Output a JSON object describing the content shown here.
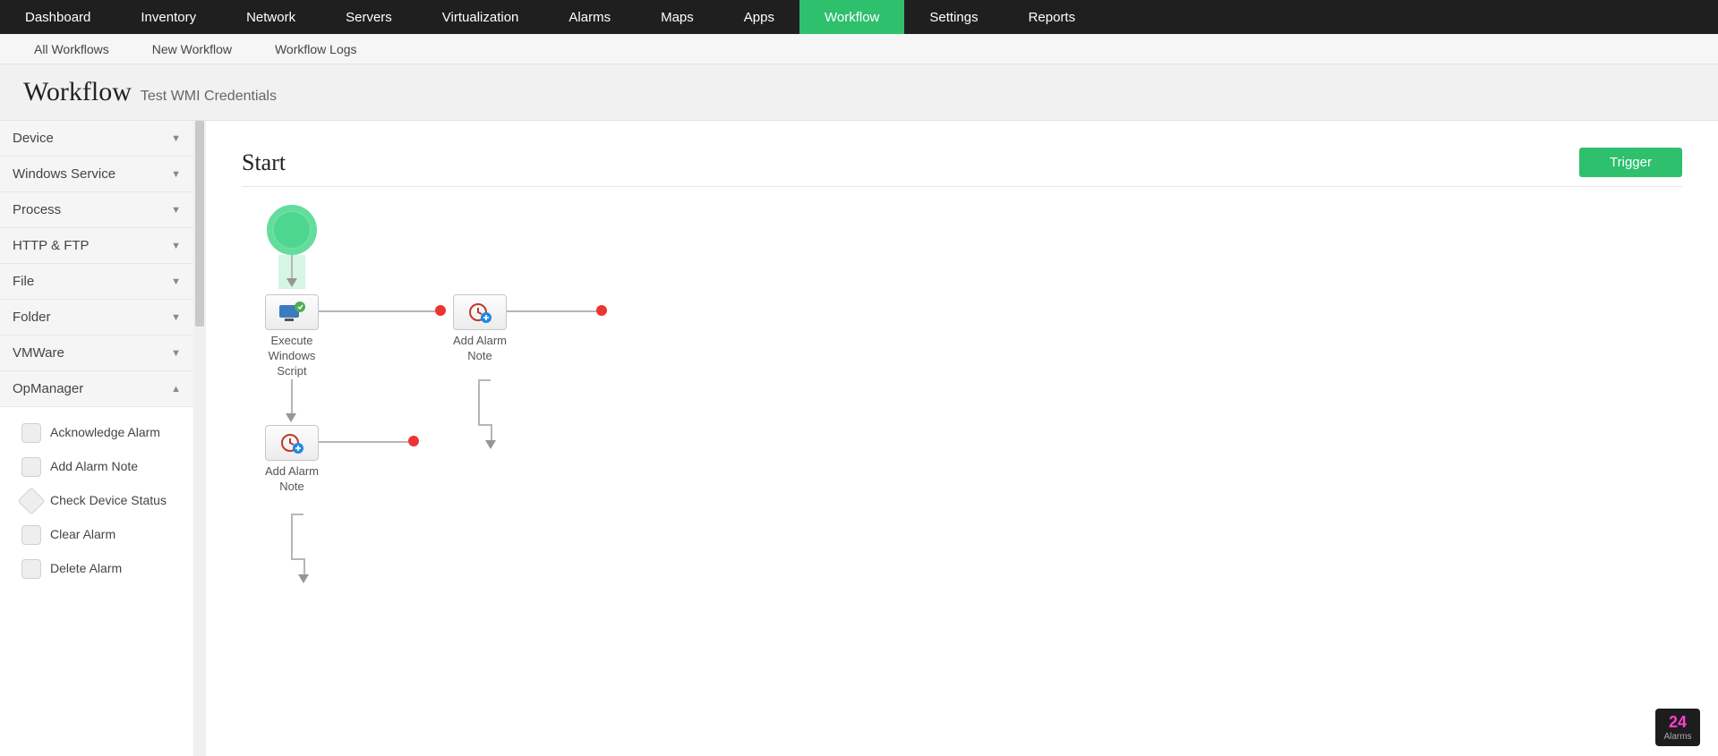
{
  "main_nav": {
    "items": [
      "Dashboard",
      "Inventory",
      "Network",
      "Servers",
      "Virtualization",
      "Alarms",
      "Maps",
      "Apps",
      "Workflow",
      "Settings",
      "Reports"
    ],
    "active_index": 8
  },
  "sub_nav": {
    "items": [
      "All Workflows",
      "New Workflow",
      "Workflow Logs"
    ]
  },
  "page": {
    "title": "Workflow",
    "subtitle": "Test WMI Credentials"
  },
  "sidebar": {
    "groups": [
      {
        "label": "Device",
        "expanded": false
      },
      {
        "label": "Windows Service",
        "expanded": false
      },
      {
        "label": "Process",
        "expanded": false
      },
      {
        "label": "HTTP & FTP",
        "expanded": false
      },
      {
        "label": "File",
        "expanded": false
      },
      {
        "label": "Folder",
        "expanded": false
      },
      {
        "label": "VMWare",
        "expanded": false
      },
      {
        "label": "OpManager",
        "expanded": true,
        "children": [
          {
            "label": "Acknowledge Alarm",
            "shape": "box"
          },
          {
            "label": "Add Alarm Note",
            "shape": "box"
          },
          {
            "label": "Check Device Status",
            "shape": "diamond"
          },
          {
            "label": "Clear Alarm",
            "shape": "box"
          },
          {
            "label": "Delete Alarm",
            "shape": "box"
          }
        ]
      }
    ]
  },
  "canvas": {
    "start_label": "Start",
    "trigger_button": "Trigger",
    "nodes": {
      "n1": "Execute Windows Script",
      "n2": "Add Alarm Note",
      "n3": "Add Alarm Note"
    }
  },
  "alarms": {
    "count": "24",
    "label": "Alarms"
  },
  "colors": {
    "accent": "#2ec06d",
    "alarm_count": "#ff3fcf"
  }
}
